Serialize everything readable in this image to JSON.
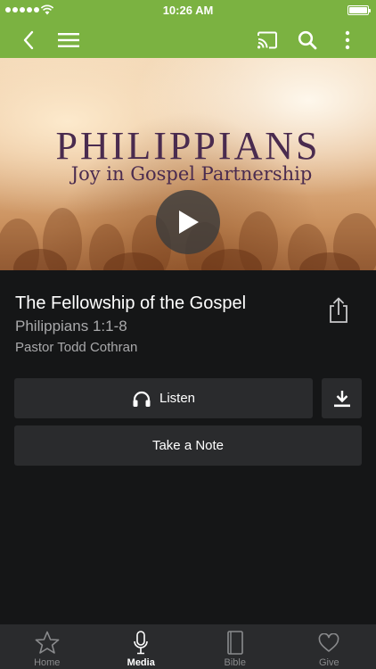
{
  "status_bar": {
    "time": "10:26 AM",
    "icons": [
      "signal-dots-icon",
      "wifi-icon",
      "battery-icon"
    ]
  },
  "nav_bar": {
    "color": "#7bb241",
    "left_icons": [
      "back-chevron-icon",
      "hamburger-menu-icon"
    ],
    "right_icons": [
      "cast-icon",
      "search-icon",
      "more-vertical-icon"
    ]
  },
  "hero": {
    "title": "PHILIPPIANS",
    "subtitle": "Joy in Gospel Partnership",
    "play_icon": "play-icon"
  },
  "sermon": {
    "title": "The Fellowship of the Gospel",
    "reference": "Philippians 1:1-8",
    "speaker": "Pastor Todd Cothran",
    "share_icon": "share-icon"
  },
  "actions": {
    "listen_label": "Listen",
    "listen_icon": "headphones-icon",
    "download_icon": "download-icon",
    "note_label": "Take a Note"
  },
  "tabs": [
    {
      "label": "Home",
      "icon": "star-icon",
      "active": false
    },
    {
      "label": "Media",
      "icon": "microphone-icon",
      "active": true
    },
    {
      "label": "Bible",
      "icon": "book-icon",
      "active": false
    },
    {
      "label": "Give",
      "icon": "heart-icon",
      "active": false
    }
  ],
  "colors": {
    "accent": "#7bb241",
    "background": "#151617",
    "button": "#2a2b2d",
    "secondary_text": "#a9a9ab",
    "hero_text": "#4a2b4f"
  }
}
